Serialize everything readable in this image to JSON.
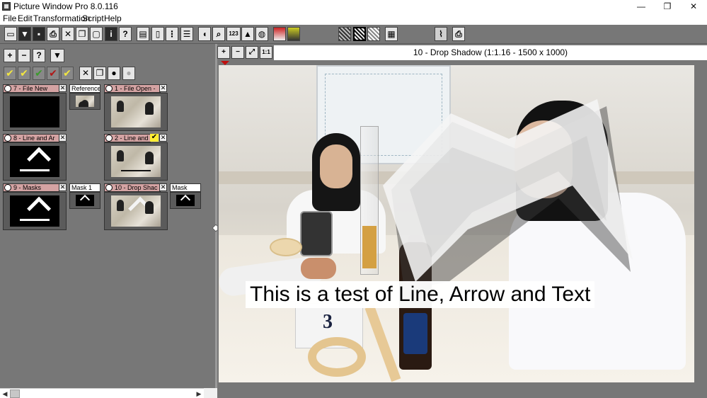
{
  "window": {
    "title": "Picture Window Pro 8.0.116",
    "minimize": "—",
    "restore": "❐",
    "close": "✕"
  },
  "menu": [
    "File",
    "Edit",
    "Transformation",
    "Script",
    "Help"
  ],
  "toolbar_icons": [
    "new-window-icon",
    "save-icon",
    "disk-icon",
    "print-icon",
    "close-icon",
    "copy-icon",
    "paste-icon",
    "info-icon",
    "help-icon",
    "panel-layout-icon",
    "panel-single-icon",
    "panel-dots-icon",
    "panel-list-icon",
    "mouse-icon",
    "zoom-icon",
    "counter-icon",
    "histogram-icon",
    "color-wheel-icon",
    "gradient-icon",
    "levels-icon",
    "pattern-dark-icon",
    "pattern-selected-icon",
    "pattern-light-icon",
    "grid-icon",
    "graph-icon",
    "print-color-icon"
  ],
  "toolbar_labels": {
    "info": "i",
    "help": "?",
    "counter": "123"
  },
  "left_panel": {
    "zoom_in": "+",
    "zoom_out": "−",
    "help": "?",
    "dropdown": "▼",
    "check_marks": [
      "✔",
      "✔",
      "✔",
      "✔",
      "✔"
    ],
    "check_colors": [
      "#f2e640",
      "#f2e640",
      "#3c9a2c",
      "#b01818",
      "#f2e640"
    ],
    "tool_close": "✕",
    "cards": [
      {
        "label": "7 - File New",
        "thumb": "black"
      },
      {
        "label": "Reference",
        "thumb": "photo-small"
      },
      {
        "label": "1 - File Open -",
        "thumb": "photo"
      },
      {
        "label": "8 - Line and Ar",
        "thumb": "arrow"
      },
      {
        "label": "2 - Line and",
        "thumb": "photo-text"
      },
      {
        "label": "9 - Masks",
        "thumb": "arrow"
      },
      {
        "label": "Mask 1",
        "thumb": "mask"
      },
      {
        "label": "10 - Drop Shac",
        "thumb": "photo-arrow"
      },
      {
        "label": "Mask",
        "thumb": "mask"
      }
    ],
    "card_close": "✕",
    "card_selected": "✔"
  },
  "image_toolbar": {
    "zoom_in": "+",
    "zoom_out": "−",
    "fit": "⤢",
    "one_to_one": "1:1",
    "title": "10 - Drop Shadow (1:1.16 - 1500 x 1000)"
  },
  "image": {
    "caption": "This is a test of Line, Arrow and Text",
    "block_number": "3"
  },
  "scrollbar": {
    "left": "◀",
    "right": "▶"
  }
}
